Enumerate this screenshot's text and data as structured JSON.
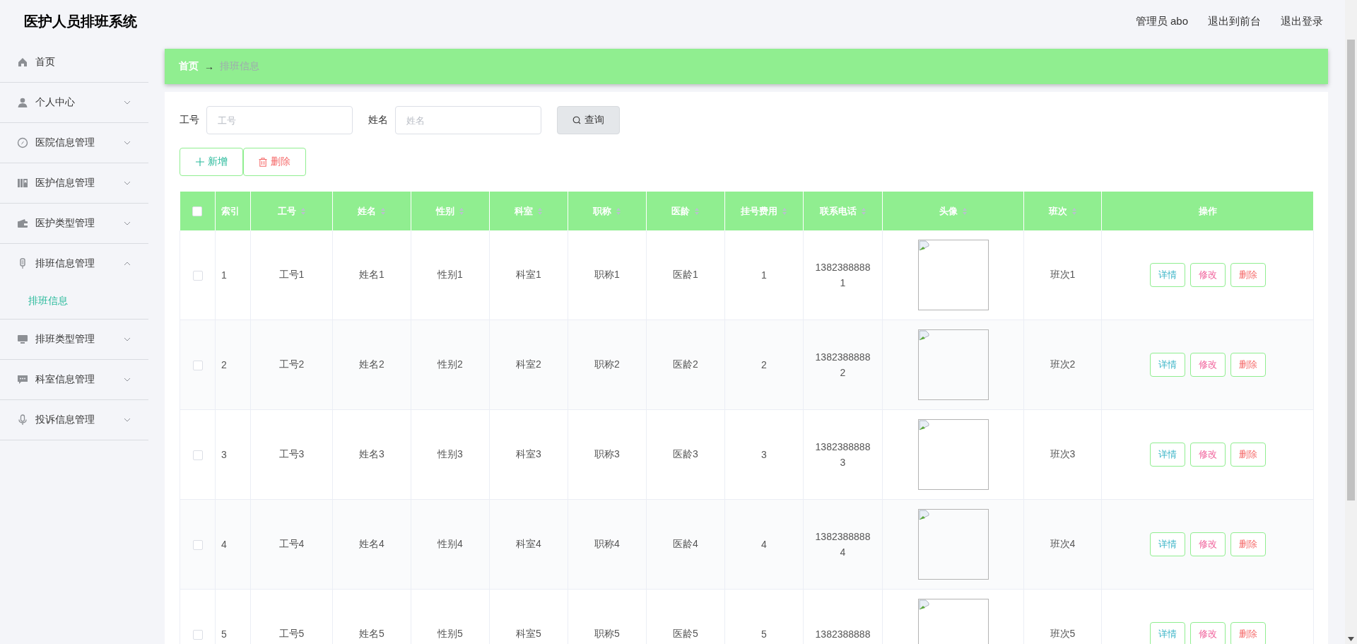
{
  "header": {
    "title": "医护人员排班系统",
    "user": "管理员 abo",
    "links": [
      "退出到前台",
      "退出登录"
    ]
  },
  "sidebar": {
    "items": [
      {
        "label": "首页",
        "selected": false
      },
      {
        "label": "个人中心",
        "expanded": false
      },
      {
        "label": "医院信息管理",
        "expanded": false
      },
      {
        "label": "医护信息管理",
        "expanded": false
      },
      {
        "label": "医护类型管理",
        "expanded": false
      },
      {
        "label": "排班信息管理",
        "expanded": true,
        "children": [
          {
            "label": "排班信息",
            "selected": true
          }
        ]
      },
      {
        "label": "排班类型管理",
        "expanded": false
      },
      {
        "label": "科室信息管理",
        "expanded": false
      },
      {
        "label": "投诉信息管理",
        "expanded": false
      }
    ]
  },
  "breadcrumb": {
    "items": [
      "首页",
      "排班信息"
    ],
    "separator": "→"
  },
  "search": {
    "fields": [
      {
        "label": "工号",
        "placeholder": "工号"
      },
      {
        "label": "姓名",
        "placeholder": "姓名"
      }
    ],
    "button": "查询"
  },
  "actions": [
    {
      "label": "新增",
      "kind": "add"
    },
    {
      "label": "删除",
      "kind": "delete"
    }
  ],
  "table": {
    "header_checkbox": {
      "checked": false
    },
    "columns": [
      {
        "label": "索引",
        "sortable": false
      },
      {
        "label": "工号",
        "sortable": true
      },
      {
        "label": "姓名",
        "sortable": true
      },
      {
        "label": "性别",
        "sortable": true
      },
      {
        "label": "科室",
        "sortable": true
      },
      {
        "label": "职称",
        "sortable": true
      },
      {
        "label": "医龄",
        "sortable": true
      },
      {
        "label": "挂号费用",
        "sortable": true
      },
      {
        "label": "联系电话",
        "sortable": true
      },
      {
        "label": "头像",
        "sortable": true
      },
      {
        "label": "班次",
        "sortable": true
      },
      {
        "label": "操作",
        "sortable": false
      }
    ],
    "rows": [
      {
        "checked": false,
        "cells": [
          "1",
          "工号1",
          "姓名1",
          "性别1",
          "科室1",
          "职称1",
          "医龄1",
          "1",
          "13823888881",
          "",
          "班次1"
        ],
        "buttons": [
          {
            "label": "详情",
            "kind": "detail"
          },
          {
            "label": "修改",
            "kind": "edit"
          },
          {
            "label": "删除",
            "kind": "delete"
          }
        ]
      },
      {
        "checked": false,
        "cells": [
          "2",
          "工号2",
          "姓名2",
          "性别2",
          "科室2",
          "职称2",
          "医龄2",
          "2",
          "13823888882",
          "",
          "班次2"
        ],
        "buttons": [
          {
            "label": "详情",
            "kind": "detail"
          },
          {
            "label": "修改",
            "kind": "edit"
          },
          {
            "label": "删除",
            "kind": "delete"
          }
        ]
      },
      {
        "checked": false,
        "cells": [
          "3",
          "工号3",
          "姓名3",
          "性别3",
          "科室3",
          "职称3",
          "医龄3",
          "3",
          "13823888883",
          "",
          "班次3"
        ],
        "buttons": [
          {
            "label": "详情",
            "kind": "detail"
          },
          {
            "label": "修改",
            "kind": "edit"
          },
          {
            "label": "删除",
            "kind": "delete"
          }
        ]
      },
      {
        "checked": false,
        "cells": [
          "4",
          "工号4",
          "姓名4",
          "性别4",
          "科室4",
          "职称4",
          "医龄4",
          "4",
          "13823888884",
          "",
          "班次4"
        ],
        "buttons": [
          {
            "label": "详情",
            "kind": "detail"
          },
          {
            "label": "修改",
            "kind": "edit"
          },
          {
            "label": "删除",
            "kind": "delete"
          }
        ]
      },
      {
        "checked": false,
        "cells": [
          "5",
          "工号5",
          "姓名5",
          "性别5",
          "科室5",
          "职称5",
          "医龄5",
          "5",
          "1382388888",
          "",
          "班次5"
        ],
        "buttons": [
          {
            "label": "详情",
            "kind": "detail"
          },
          {
            "label": "修改",
            "kind": "edit"
          },
          {
            "label": "删除",
            "kind": "delete"
          }
        ]
      }
    ]
  }
}
